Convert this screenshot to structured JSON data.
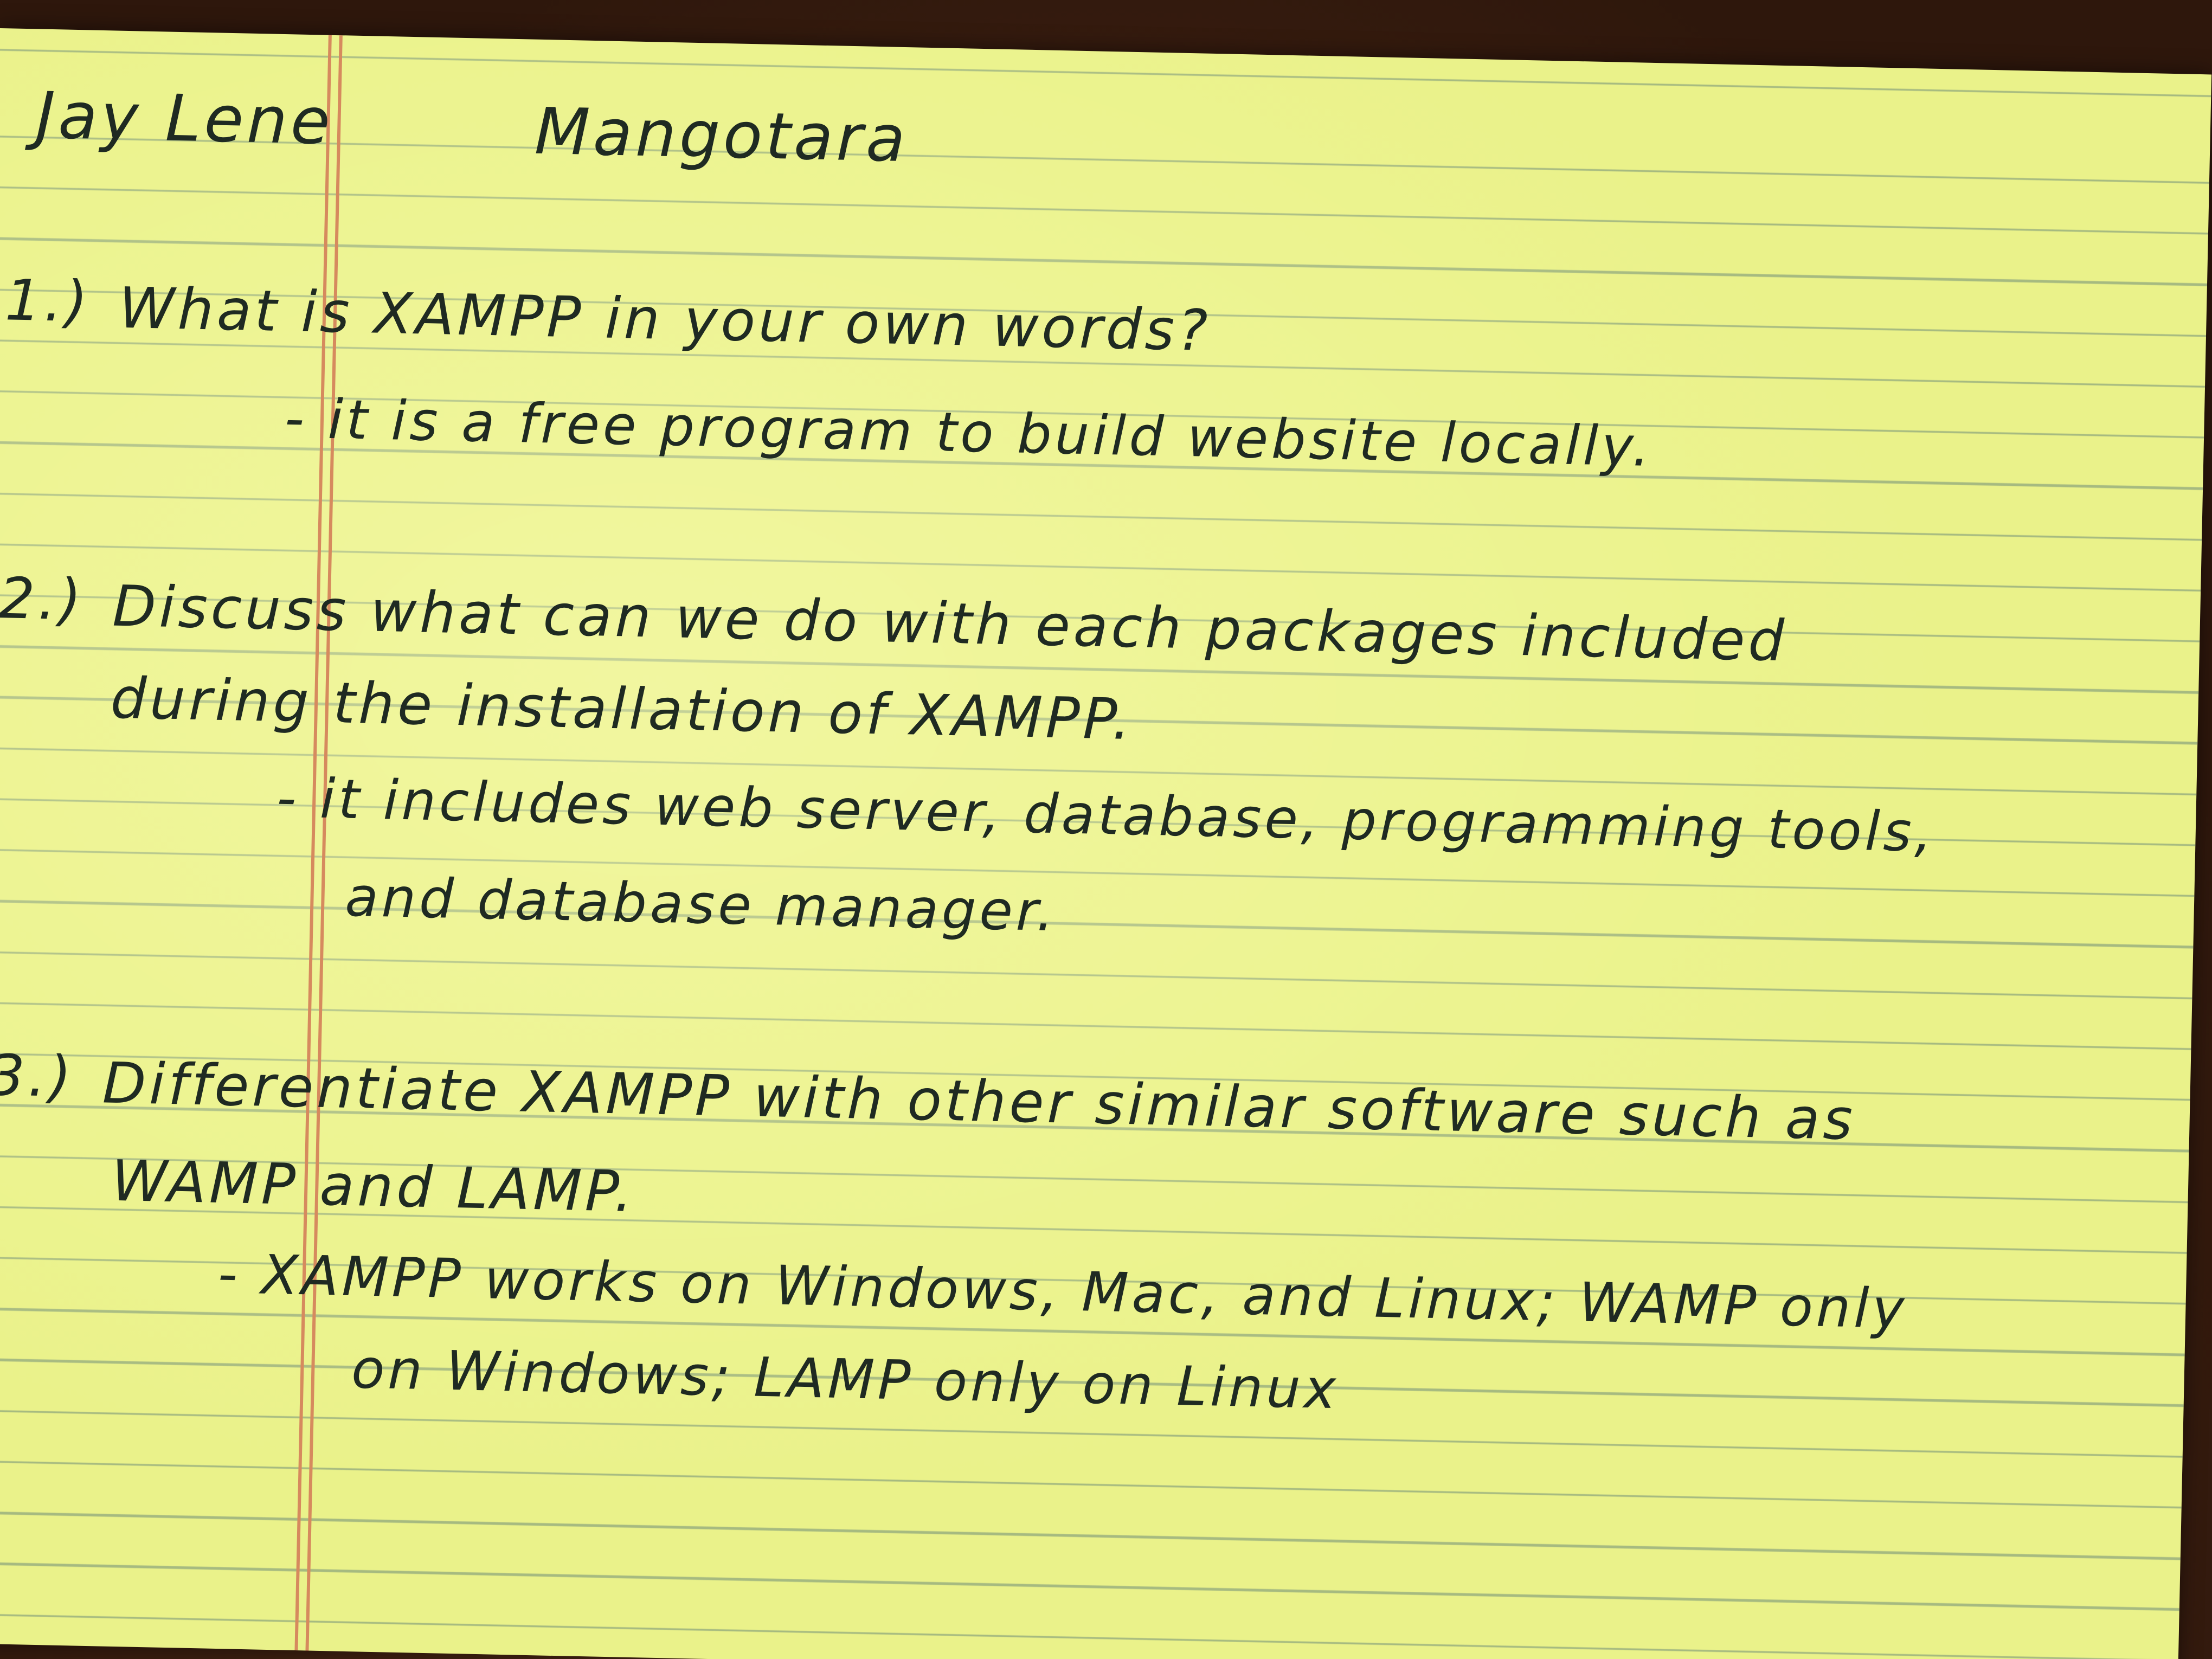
{
  "note": {
    "name_first": "Jay Lene",
    "name_last": "Mangotara",
    "questions": [
      {
        "number": "1.)",
        "lines": [
          "What is XAMPP in your own words?"
        ],
        "answer": [
          "- it is a free program to build website locally."
        ]
      },
      {
        "number": "2.)",
        "lines": [
          "Discuss what can we do with each packages included",
          "during the installation of XAMPP."
        ],
        "answer": [
          "- it includes web server, database, programming tools,",
          "and database manager."
        ]
      },
      {
        "number": "3.)",
        "lines": [
          "Differentiate XAMPP with other similar software such as",
          "WAMP and LAMP."
        ],
        "answer": [
          "- XAMPP works on Windows, Mac, and Linux; WAMP only",
          "on Windows; LAMP only on Linux"
        ]
      }
    ]
  }
}
